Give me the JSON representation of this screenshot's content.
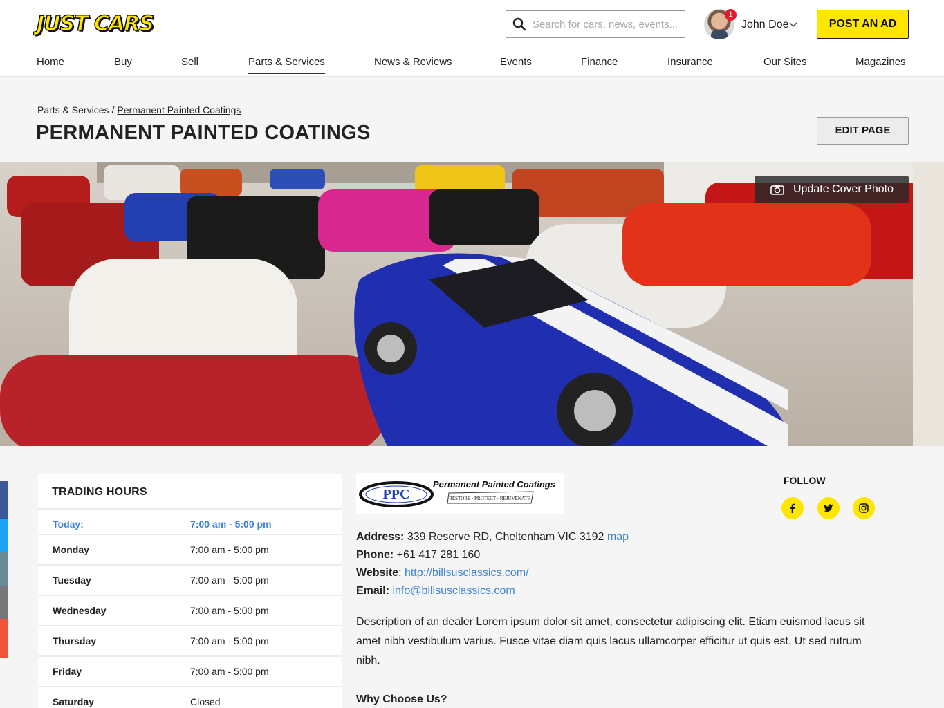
{
  "header": {
    "logo_text": "JUST CARS",
    "search_placeholder": "Search for cars, news, events...",
    "user_name": "John Doe",
    "notification_count": "1",
    "post_ad_label": "POST AN AD"
  },
  "nav": {
    "items": [
      "Home",
      "Buy",
      "Sell",
      "Parts & Services",
      "News & Reviews",
      "Events",
      "Finance",
      "Insurance",
      "Our Sites",
      "Magazines"
    ],
    "active": "Parts & Services"
  },
  "breadcrumb": {
    "parent": "Parts & Services",
    "separator": "/",
    "current": "Permanent Painted Coatings"
  },
  "page": {
    "title": "PERMANENT PAINTED COATINGS",
    "edit_label": "EDIT PAGE",
    "update_cover_label": "Update Cover Photo"
  },
  "trading_hours": {
    "title": "TRADING HOURS",
    "rows": [
      {
        "day": "Today:",
        "time": "7:00 am - 5:00 pm"
      },
      {
        "day": "Monday",
        "time": "7:00 am - 5:00 pm"
      },
      {
        "day": "Tuesday",
        "time": "7:00 am - 5:00 pm"
      },
      {
        "day": "Wednesday",
        "time": "7:00 am - 5:00 pm"
      },
      {
        "day": "Thursday",
        "time": "7:00 am - 5:00 pm"
      },
      {
        "day": "Friday",
        "time": "7:00 am - 5:00 pm"
      },
      {
        "day": "Saturday",
        "time": "Closed"
      }
    ]
  },
  "business": {
    "logo_abbr": "PPC",
    "logo_name": "Permanent Painted Coatings",
    "logo_tagline": "RESTORE · PROTECT · REJUVENATE",
    "address_label": "Address:",
    "address": "339 Reserve RD, Cheltenham VIC 3192",
    "map_link": "map",
    "phone_label": "Phone:",
    "phone": "+61 417 281 160",
    "website_label": "Website",
    "website": "http://billsusclassics.com/",
    "email_label": "Email:",
    "email": "info@billsusclassics.com",
    "description": "Description of an dealer Lorem ipsum dolor sit amet, consectetur adipiscing elit. Etiam euismod lacus sit amet nibh vestibulum varius. Fusce vitae diam quis lacus ullamcorper efficitur ut quis est. Ut sed rutrum nibh.",
    "why_heading": "Why Choose Us?"
  },
  "follow": {
    "title": "FOLLOW",
    "icons": [
      "facebook-icon",
      "twitter-icon",
      "instagram-icon"
    ]
  },
  "colors": {
    "brand_yellow": "#ffe600",
    "link_blue": "#3b82d6",
    "side_strip": [
      "#3b5998",
      "#1da1f2",
      "#6a8a93",
      "#777777",
      "#f0553a"
    ]
  }
}
